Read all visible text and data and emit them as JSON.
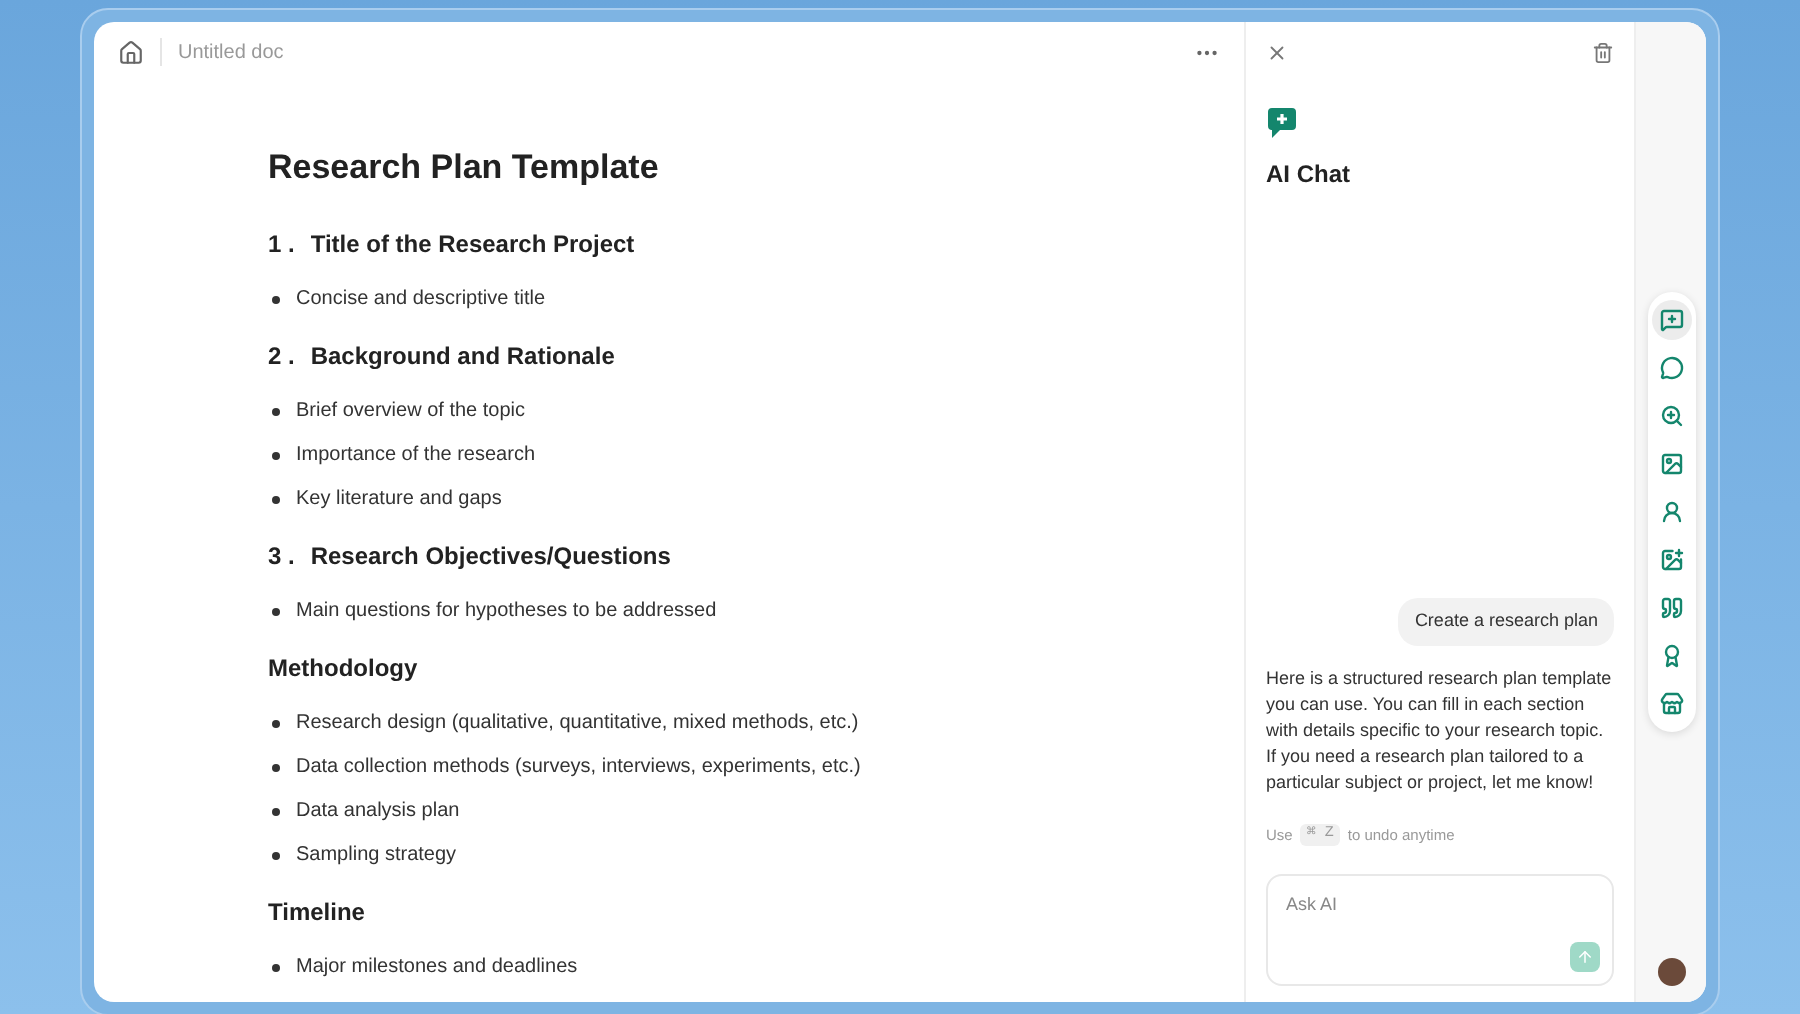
{
  "topbar": {
    "doc_title": "Untitled doc"
  },
  "document": {
    "title": "Research Plan Template",
    "blocks": [
      {
        "kind": "heading",
        "number": "1 .",
        "text": "Title of the Research Project"
      },
      {
        "kind": "bullet",
        "text": "Concise and descriptive title"
      },
      {
        "kind": "heading",
        "number": "2 .",
        "text": "Background and Rationale"
      },
      {
        "kind": "bullet",
        "text": "Brief overview of the topic"
      },
      {
        "kind": "bullet",
        "text": "Importance of the research"
      },
      {
        "kind": "bullet",
        "text": "Key literature and gaps"
      },
      {
        "kind": "heading",
        "number": "3 .",
        "text": "Research Objectives/Questions"
      },
      {
        "kind": "bullet",
        "text": "Main questions for hypotheses to be addressed"
      },
      {
        "kind": "heading",
        "text": "Methodology"
      },
      {
        "kind": "bullet",
        "text": "Research design (qualitative, quantitative, mixed methods, etc.)"
      },
      {
        "kind": "bullet",
        "text": "Data collection methods (surveys, interviews, experiments, etc.)"
      },
      {
        "kind": "bullet",
        "text": "Data analysis plan"
      },
      {
        "kind": "bullet",
        "text": "Sampling strategy"
      },
      {
        "kind": "heading",
        "text": "Timeline"
      },
      {
        "kind": "bullet",
        "text": "Major milestones and deadlines"
      }
    ]
  },
  "chat": {
    "title": "AI Chat",
    "messages": [
      {
        "kind": "user",
        "text": "Create a research plan"
      },
      {
        "kind": "assistant",
        "text": "Here is a structured research plan template you can use. You can fill in each section with details specific to your research topic. If you need a research plan tailored to a particular subject or project, let me know!"
      }
    ],
    "undo_hint": {
      "before": "Use",
      "key": "⌘ Z",
      "after": "to undo anytime"
    },
    "input": {
      "placeholder": "Ask AI"
    }
  },
  "rail": {
    "items": [
      {
        "kind": "chat",
        "selected": true
      },
      {
        "kind": "bubble",
        "selected": false
      },
      {
        "kind": "zoom",
        "selected": false
      },
      {
        "kind": "image",
        "selected": false
      },
      {
        "kind": "person",
        "selected": false
      },
      {
        "kind": "photo",
        "selected": false
      },
      {
        "kind": "quote",
        "selected": false
      },
      {
        "kind": "badge",
        "selected": false
      },
      {
        "kind": "store",
        "selected": false
      }
    ]
  }
}
